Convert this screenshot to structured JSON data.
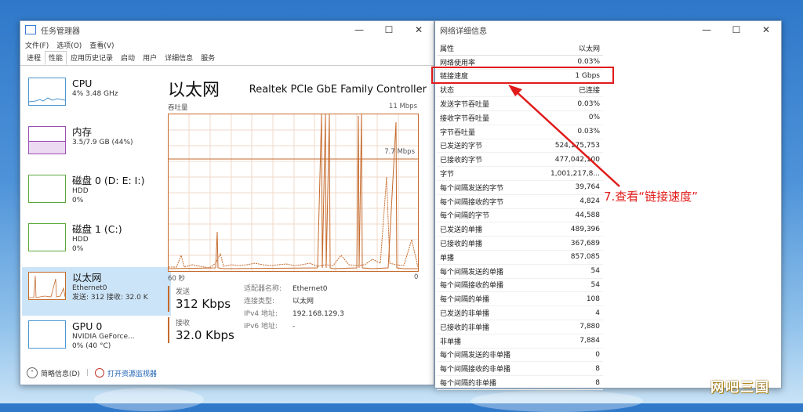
{
  "taskmgr": {
    "title": "任务管理器",
    "menu": [
      "文件(F)",
      "选项(O)",
      "查看(V)"
    ],
    "tabs": [
      "进程",
      "性能",
      "应用历史记录",
      "启动",
      "用户",
      "详细信息",
      "服务"
    ],
    "active_tab": 1,
    "sidebar": [
      {
        "name": "CPU",
        "sub1": "4% 3.48 GHz",
        "sub2": "",
        "sub3": ""
      },
      {
        "name": "内存",
        "sub1": "3.5/7.9 GB (44%)",
        "sub2": "",
        "sub3": ""
      },
      {
        "name": "磁盘 0 (D: E: I:)",
        "sub1": "HDD",
        "sub2": "0%",
        "sub3": ""
      },
      {
        "name": "磁盘 1 (C:)",
        "sub1": "HDD",
        "sub2": "0%",
        "sub3": ""
      },
      {
        "name": "以太网",
        "sub1": "Ethernet0",
        "sub2": "发送: 312 接收: 32.0 K",
        "sub3": ""
      },
      {
        "name": "GPU 0",
        "sub1": "NVIDIA GeForce...",
        "sub2": "0% (40 °C)",
        "sub3": ""
      }
    ],
    "main": {
      "title": "以太网",
      "model": "Realtek PCIe GbE Family Controller",
      "throughput_label": "吞吐量",
      "max_label": "11 Mbps",
      "mid_label": "7.7 Mbps",
      "time_left": "60 秒",
      "time_right": "0",
      "send_label": "发送",
      "send_value": "312 Kbps",
      "recv_label": "接收",
      "recv_value": "32.0 Kbps",
      "adapter": [
        {
          "k": "适配器名称:",
          "v": "Ethernet0"
        },
        {
          "k": "连接类型:",
          "v": "以太网"
        },
        {
          "k": "IPv4 地址:",
          "v": "192.168.129.3"
        },
        {
          "k": "IPv6 地址:",
          "v": "-"
        }
      ]
    },
    "footer": {
      "brief": "简略信息(D)",
      "monitor": "打开资源监视器"
    }
  },
  "netdetails": {
    "title": "网络详细信息",
    "header": {
      "p": "属性",
      "v": "以太网"
    },
    "rows": [
      {
        "p": "网络使用率",
        "v": "0.03%"
      },
      {
        "p": "链接速度",
        "v": "1 Gbps"
      },
      {
        "p": "状态",
        "v": "已连接"
      },
      {
        "p": "发送字节吞吐量",
        "v": "0.03%"
      },
      {
        "p": "接收字节吞吐量",
        "v": "0%"
      },
      {
        "p": "字节吞吐量",
        "v": "0.03%"
      },
      {
        "p": "已发送的字节",
        "v": "524,175,753"
      },
      {
        "p": "已接收的字节",
        "v": "477,042,100"
      },
      {
        "p": "字节",
        "v": "1,001,217,8..."
      },
      {
        "p": "每个间隔发送的字节",
        "v": "39,764"
      },
      {
        "p": "每个间隔接收的字节",
        "v": "4,824"
      },
      {
        "p": "每个间隔的字节",
        "v": "44,588"
      },
      {
        "p": "已发送的单播",
        "v": "489,396"
      },
      {
        "p": "已接收的单播",
        "v": "367,689"
      },
      {
        "p": "单播",
        "v": "857,085"
      },
      {
        "p": "每个间隔发送的单播",
        "v": "54"
      },
      {
        "p": "每个间隔接收的单播",
        "v": "54"
      },
      {
        "p": "每个间隔的单播",
        "v": "108"
      },
      {
        "p": "已发送的非单播",
        "v": "4"
      },
      {
        "p": "已接收的非单播",
        "v": "7,880"
      },
      {
        "p": "非单播",
        "v": "7,884"
      },
      {
        "p": "每个间隔发送的非单播",
        "v": "0"
      },
      {
        "p": "每个间隔接收的非单播",
        "v": "8"
      },
      {
        "p": "每个间隔的非单播",
        "v": "8"
      }
    ]
  },
  "annotation": "7.查看“链接速度”",
  "watermark": "网吧三国",
  "colors": {
    "accent": "#c56a2c",
    "highlight": "#e01b1b",
    "selected": "#cce4f7"
  }
}
